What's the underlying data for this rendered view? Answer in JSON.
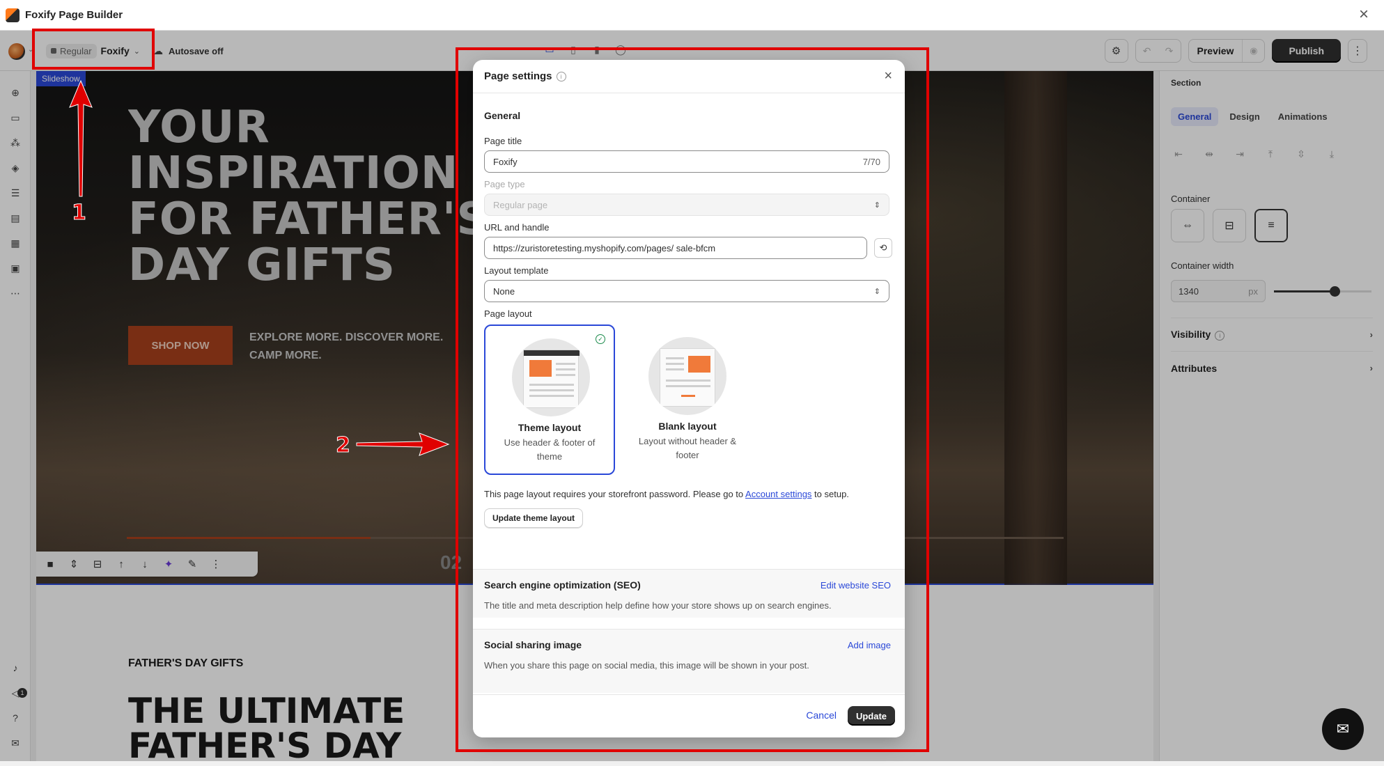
{
  "window": {
    "title": "Foxify Page Builder"
  },
  "toolbar": {
    "badge": "Regular",
    "store": "Foxify",
    "autosave": "Autosave off",
    "preview": "Preview",
    "publish": "Publish"
  },
  "canvas": {
    "tag": "Slideshow",
    "hero_title": "YOUR\nINSPIRATION\nFOR FATHER'S\nDAY GIFTS",
    "shop_btn": "SHOP NOW",
    "hero_sub": "EXPLORE MORE. DISCOVER MORE. CAMP MORE.",
    "slide_number": "02",
    "slide_progress": 0.26,
    "fd_label": "FATHER'S DAY GIFTS",
    "fd_title": "THE ULTIMATE\nFATHER'S DAY"
  },
  "right_panel": {
    "section": "Section",
    "tabs": [
      "General",
      "Design",
      "Animations"
    ],
    "active_tab": "General",
    "container_label": "Container",
    "width_label": "Container width",
    "width_value": "1340",
    "width_unit": "px",
    "visibility": "Visibility",
    "attributes": "Attributes"
  },
  "modal": {
    "title": "Page settings",
    "general": "General",
    "page_title_label": "Page title",
    "page_title_value": "Foxify",
    "page_title_counter": "7/70",
    "page_type_label": "Page type",
    "page_type_value": "Regular page",
    "url_label": "URL and handle",
    "url_value": "https://zuristoretesting.myshopify.com/pages/  sale-bfcm",
    "layout_template_label": "Layout template",
    "layout_template_value": "None",
    "page_layout_label": "Page layout",
    "layouts": [
      {
        "name": "Theme layout",
        "desc": "Use header & footer of theme"
      },
      {
        "name": "Blank layout",
        "desc": "Layout without header & footer"
      }
    ],
    "note_pre": "This page layout requires your storefront password. Please go to ",
    "note_link": "Account settings",
    "note_post": " to setup.",
    "update_theme_btn": "Update theme layout",
    "seo_title": "Search engine optimization (SEO)",
    "seo_link": "Edit website SEO",
    "seo_desc": "The title and meta description help define how your store shows up on search engines.",
    "social_title": "Social sharing image",
    "social_link": "Add image",
    "social_desc": "When you share this page on social media, this image will be shown in your post.",
    "cancel": "Cancel",
    "update": "Update"
  },
  "annotations": {
    "one": "1",
    "two": "2"
  },
  "colors": {
    "accent": "#2a48d8",
    "annotation_red": "#e00000",
    "brand_orange": "#a8401c"
  }
}
